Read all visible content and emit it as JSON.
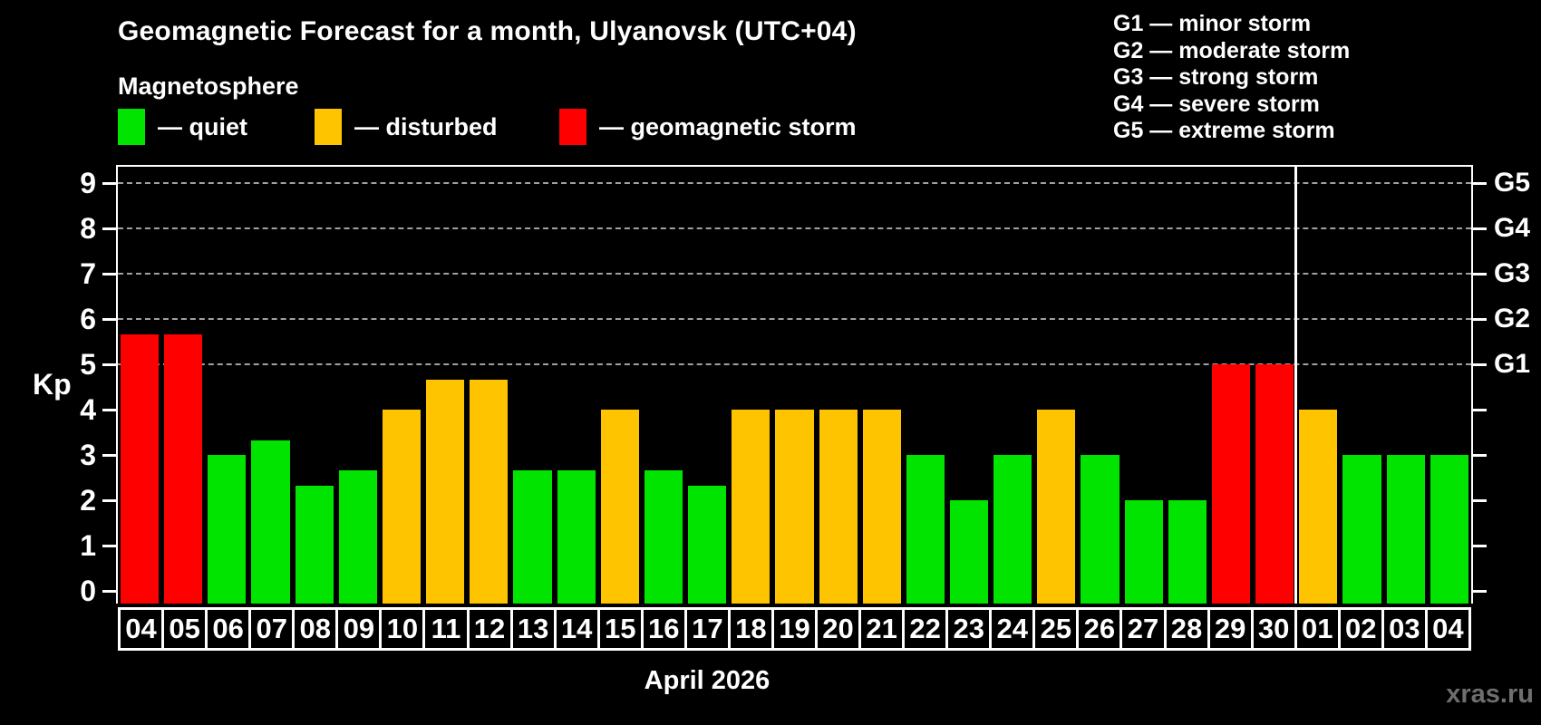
{
  "watermark": "xras.ru",
  "colors": {
    "background": "#000000",
    "quiet": "#00e400",
    "disturbed": "#ffc400",
    "storm": "#fe0000",
    "frame": "#ffffff",
    "gridline": "#a0a0a0",
    "watermark_text": "#6e6e6e"
  },
  "chart_data": {
    "type": "bar",
    "title": "Geomagnetic Forecast for a month, Ulyanovsk (UTC+04)",
    "subtitle": "Magnetosphere",
    "ylabel": "Kp",
    "xlabel": "April 2026",
    "ylim": [
      0,
      9
    ],
    "y_ticks": [
      0,
      1,
      2,
      3,
      4,
      5,
      6,
      7,
      8,
      9
    ],
    "gridlines_at_kp": [
      5,
      6,
      7,
      8,
      9
    ],
    "grid": "dashed horizontal at storm levels only",
    "legend_position": "top-left",
    "legend": [
      {
        "state": "quiet",
        "color": "#00e400",
        "label": "— quiet"
      },
      {
        "state": "disturbed",
        "color": "#ffc400",
        "label": "— disturbed"
      },
      {
        "state": "storm",
        "color": "#fe0000",
        "label": "— geomagnetic storm"
      }
    ],
    "storm_scale_legend": [
      "G1 — minor storm",
      "G2 — moderate storm",
      "G3 — strong storm",
      "G4 — severe storm",
      "G5 — extreme storm"
    ],
    "right_axis_labels": [
      {
        "label": "G5",
        "kp": 9
      },
      {
        "label": "G4",
        "kp": 8
      },
      {
        "label": "G3",
        "kp": 7
      },
      {
        "label": "G2",
        "kp": 6
      },
      {
        "label": "G1",
        "kp": 5
      }
    ],
    "month_label": "April 2026",
    "next_month_start_index": 27,
    "categories": [
      "04",
      "05",
      "06",
      "07",
      "08",
      "09",
      "10",
      "11",
      "12",
      "13",
      "14",
      "15",
      "16",
      "17",
      "18",
      "19",
      "20",
      "21",
      "22",
      "23",
      "24",
      "25",
      "26",
      "27",
      "28",
      "29",
      "30",
      "01",
      "02",
      "03",
      "04"
    ],
    "values": [
      5.67,
      5.67,
      3,
      3.33,
      2.33,
      2.67,
      4,
      4.67,
      4.67,
      2.67,
      2.67,
      4,
      2.67,
      2.33,
      4,
      4,
      4,
      4,
      3,
      2,
      3,
      4,
      3,
      2,
      2,
      5,
      5,
      4,
      3,
      3,
      3
    ],
    "states": [
      "storm",
      "storm",
      "quiet",
      "quiet",
      "quiet",
      "quiet",
      "disturbed",
      "disturbed",
      "disturbed",
      "quiet",
      "quiet",
      "disturbed",
      "quiet",
      "quiet",
      "disturbed",
      "disturbed",
      "disturbed",
      "disturbed",
      "quiet",
      "quiet",
      "quiet",
      "disturbed",
      "quiet",
      "quiet",
      "quiet",
      "storm",
      "storm",
      "disturbed",
      "quiet",
      "quiet",
      "quiet"
    ]
  }
}
